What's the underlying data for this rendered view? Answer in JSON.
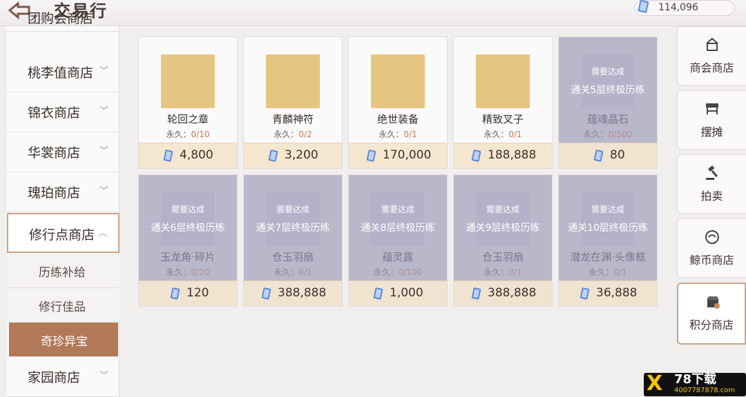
{
  "header": {
    "title": "交易行",
    "currency": "114,096"
  },
  "sidebar": {
    "top_partial": "团购会商店",
    "items": [
      "桃李值商店",
      "锦衣商店",
      "华裳商店",
      "瑰珀商店",
      "修行点商店"
    ],
    "subs": [
      "历练补给",
      "修行佳品",
      "奇珍异宝"
    ],
    "bottom": "家园商店"
  },
  "items": [
    {
      "name": "轮回之章",
      "limit": "永久：",
      "count": "0/10",
      "price": "4,800",
      "locked": false
    },
    {
      "name": "青麟神符",
      "limit": "永久：",
      "count": "0/2",
      "price": "3,200",
      "locked": false
    },
    {
      "name": "绝世装备",
      "limit": "永久：",
      "count": "0/1",
      "price": "170,000",
      "locked": false
    },
    {
      "name": "精致叉子",
      "limit": "永久：",
      "count": "0/1",
      "price": "188,888",
      "locked": false
    },
    {
      "name": "蕴魂晶石",
      "limit": "永久：",
      "count": "0/500",
      "price": "80",
      "locked": true,
      "req": "需要达成",
      "cond": "通关5层终极历练"
    },
    {
      "name": "玉龙角·碎片",
      "limit": "永久：",
      "count": "0/20",
      "price": "120",
      "locked": true,
      "req": "需要达成",
      "cond": "通关6层终极历练"
    },
    {
      "name": "仓玉羽扇",
      "limit": "永久：",
      "count": "0/1",
      "price": "388,888",
      "locked": true,
      "req": "需要达成",
      "cond": "通关7层终极历练"
    },
    {
      "name": "蕴灵露",
      "limit": "永久：",
      "count": "0/100",
      "price": "1,000",
      "locked": true,
      "req": "需要达成",
      "cond": "通关8层终极历练"
    },
    {
      "name": "仓玉羽扇",
      "limit": "永久：",
      "count": "0/1",
      "price": "388,888",
      "locked": true,
      "req": "需要达成",
      "cond": "通关9层终极历练"
    },
    {
      "name": "潜龙在渊·头像框",
      "limit": "永久：",
      "count": "0/1",
      "price": "36,888",
      "locked": true,
      "req": "需要达成",
      "cond": "通关10层终极历练"
    }
  ],
  "right_nav": [
    "商会商店",
    "摆摊",
    "拍卖",
    "鲸币商店",
    "积分商店"
  ],
  "watermark": {
    "brand": "78下载",
    "url": "4007787878.com"
  },
  "colors": {
    "accent": "#b27958",
    "price_bg": "#f4e6cf"
  }
}
